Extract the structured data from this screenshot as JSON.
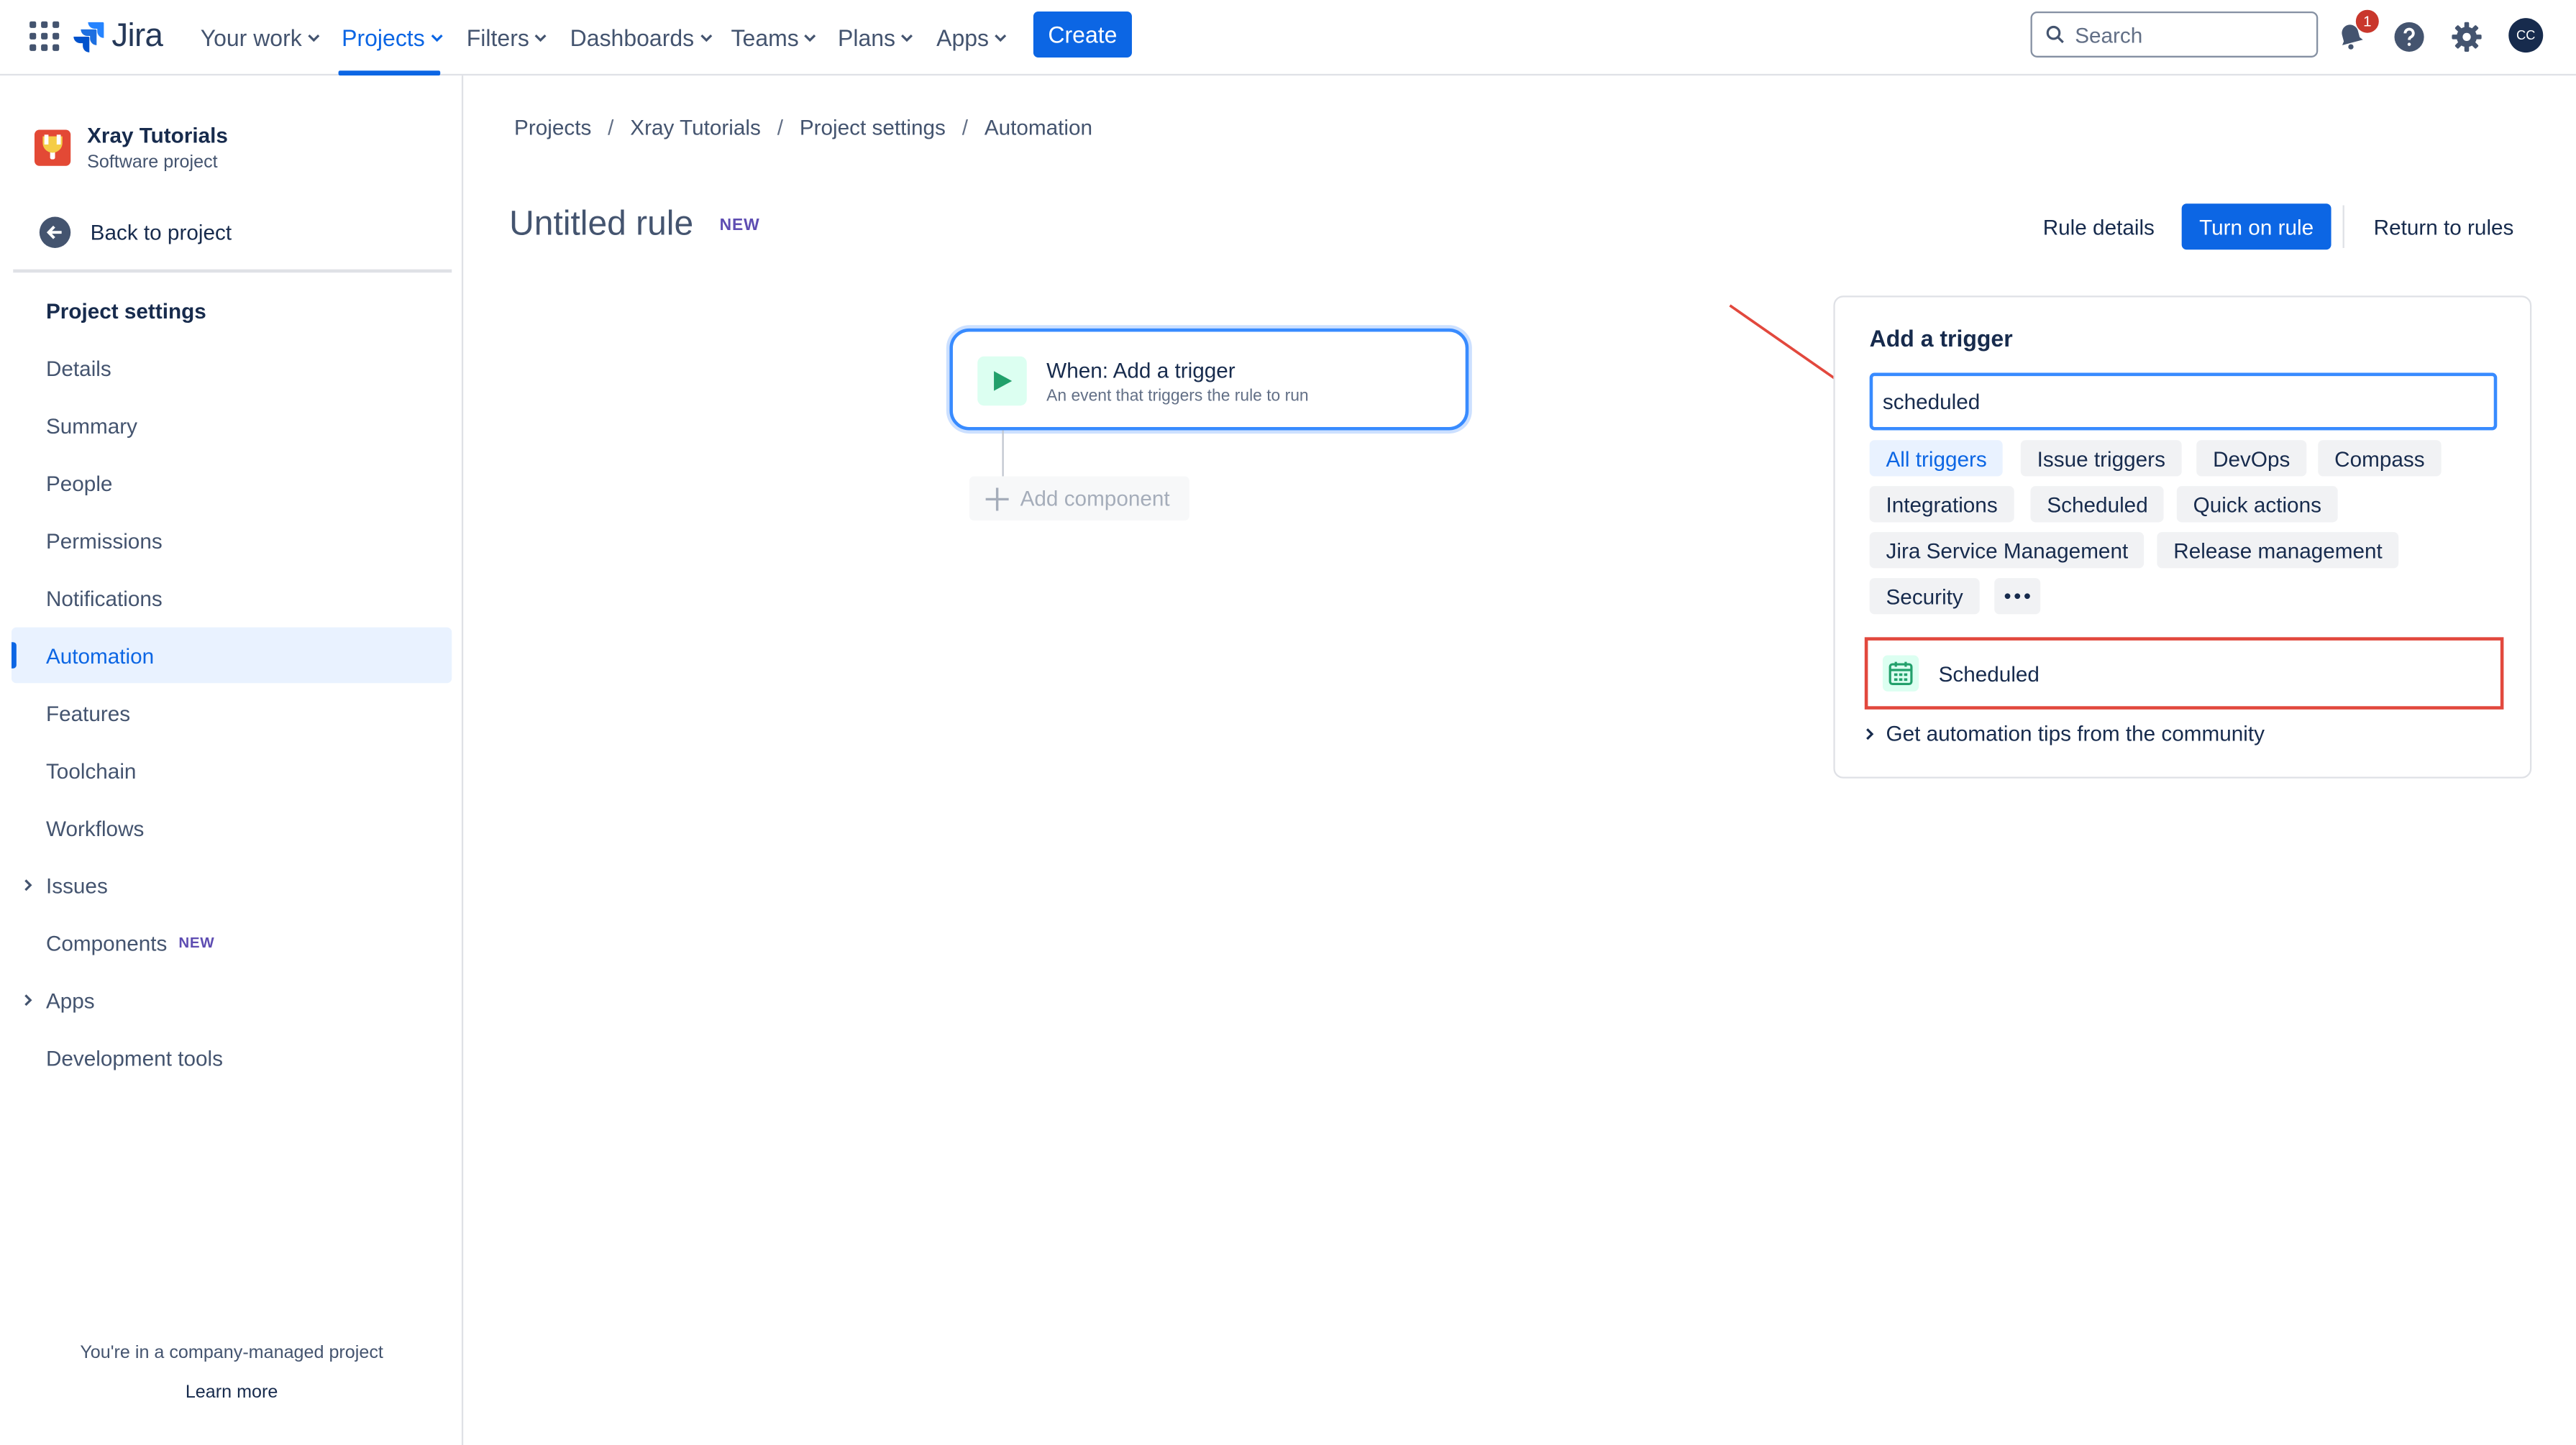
{
  "nav": {
    "logo_text": "Jira",
    "items": [
      {
        "label": "Your work"
      },
      {
        "label": "Projects"
      },
      {
        "label": "Filters"
      },
      {
        "label": "Dashboards"
      },
      {
        "label": "Teams"
      },
      {
        "label": "Plans"
      },
      {
        "label": "Apps"
      }
    ],
    "active_item": "Projects",
    "create_label": "Create",
    "search_placeholder": "Search",
    "notification_count": "1",
    "avatar_initials": "CC",
    "icons": [
      "app-switcher-icon",
      "jira-logo-icon",
      "search-icon",
      "notification-icon",
      "help-icon",
      "settings-icon"
    ]
  },
  "sidebar": {
    "project_name": "Xray Tutorials",
    "project_type": "Software project",
    "back_label": "Back to project",
    "heading": "Project settings",
    "items": [
      {
        "label": "Details"
      },
      {
        "label": "Summary"
      },
      {
        "label": "People"
      },
      {
        "label": "Permissions"
      },
      {
        "label": "Notifications"
      },
      {
        "label": "Automation"
      },
      {
        "label": "Features"
      },
      {
        "label": "Toolchain"
      },
      {
        "label": "Workflows"
      },
      {
        "label": "Issues"
      },
      {
        "label": "Components",
        "tag": "NEW"
      },
      {
        "label": "Apps"
      },
      {
        "label": "Development tools"
      }
    ],
    "selected_item": "Automation",
    "footer_text": "You're in a company-managed project",
    "footer_link": "Learn more"
  },
  "breadcrumbs": [
    "Projects",
    "Xray Tutorials",
    "Project settings",
    "Automation"
  ],
  "rule": {
    "title": "Untitled rule",
    "tag": "NEW",
    "details_label": "Rule details",
    "turn_on_label": "Turn on rule",
    "return_label": "Return to rules"
  },
  "canvas": {
    "trigger_title": "When: Add a trigger",
    "trigger_subtitle": "An event that triggers the rule to run",
    "add_component_label": "Add component"
  },
  "panel": {
    "title": "Add a trigger",
    "search_value": "scheduled",
    "chips": [
      "All triggers",
      "Issue triggers",
      "DevOps",
      "Compass",
      "Integrations",
      "Scheduled",
      "Quick actions",
      "Jira Service Management",
      "Release management",
      "Security"
    ],
    "active_chip": "All triggers",
    "result_label": "Scheduled",
    "tips_label": "Get automation tips from the community"
  },
  "colors": {
    "brand_blue": "#0c66e4",
    "annotation_red": "#e2483d",
    "focus_blue": "#388bff"
  }
}
